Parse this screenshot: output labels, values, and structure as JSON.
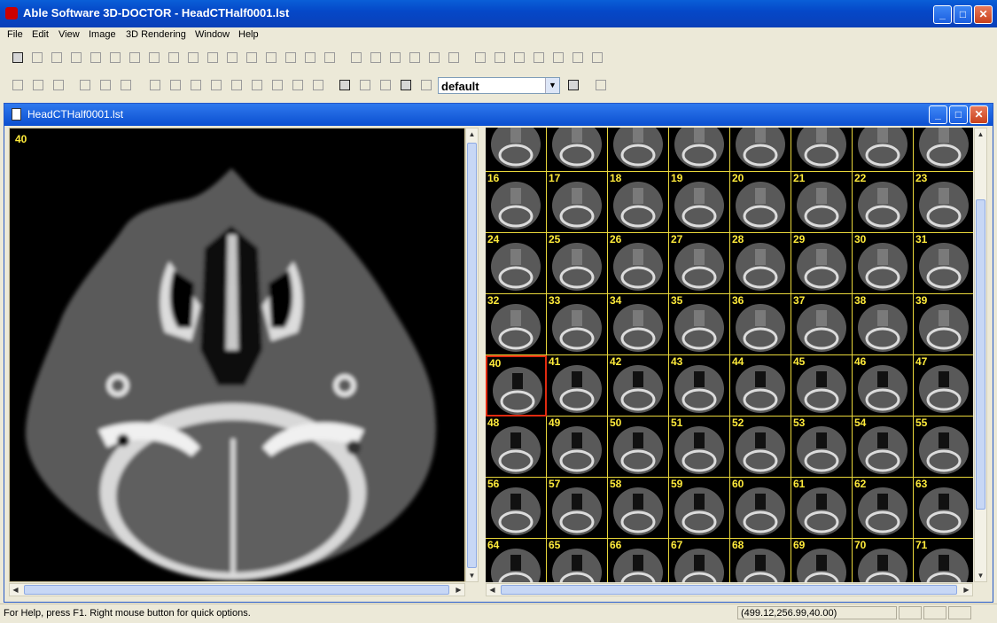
{
  "window": {
    "title": "Able Software 3D-DOCTOR - HeadCTHalf0001.lst"
  },
  "menu": [
    "File",
    "Edit",
    "View",
    "Image",
    "3D Rendering",
    "Window",
    "Help"
  ],
  "toolbar": {
    "style_value": "default"
  },
  "document": {
    "title": "HeadCTHalf0001.lst",
    "current_slice": "40"
  },
  "thumbnails": {
    "first_row_numbers": [
      "",
      "",
      "",
      "",
      "",
      "",
      "",
      ""
    ],
    "numbers": [
      "16",
      "17",
      "18",
      "19",
      "20",
      "21",
      "22",
      "23",
      "24",
      "25",
      "26",
      "27",
      "28",
      "29",
      "30",
      "31",
      "32",
      "33",
      "34",
      "35",
      "36",
      "37",
      "38",
      "39",
      "40",
      "41",
      "42",
      "43",
      "44",
      "45",
      "46",
      "47",
      "48",
      "49",
      "50",
      "51",
      "52",
      "53",
      "54",
      "55",
      "56",
      "57",
      "58",
      "59",
      "60",
      "61",
      "62",
      "63",
      "64",
      "65",
      "66",
      "67",
      "68",
      "69",
      "70",
      "71"
    ],
    "selected": "40"
  },
  "status": {
    "help_text": "For Help, press F1. Right mouse button for quick options.",
    "coordinates": "(499.12,256.99,40.00)"
  }
}
